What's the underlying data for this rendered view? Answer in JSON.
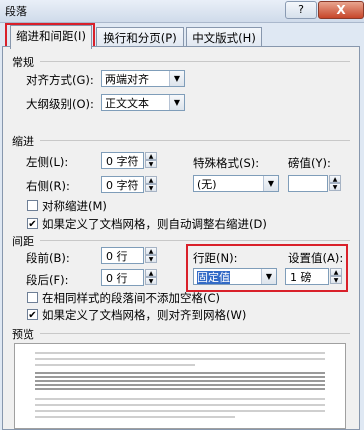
{
  "window": {
    "title": "段落",
    "help_label": "?",
    "close_label": "X"
  },
  "tabs": [
    {
      "label": "缩进和间距(I)",
      "active": true
    },
    {
      "label": "换行和分页(P)",
      "active": false
    },
    {
      "label": "中文版式(H)",
      "active": false
    }
  ],
  "general": {
    "section_label": "常规",
    "alignment_label": "对齐方式(G):",
    "alignment_value": "两端对齐",
    "outline_label": "大纲级别(O):",
    "outline_value": "正文文本"
  },
  "indent": {
    "section_label": "缩进",
    "left_label": "左侧(L):",
    "left_value": "0 字符",
    "right_label": "右侧(R):",
    "right_value": "0 字符",
    "special_label": "特殊格式(S):",
    "special_value": "(无)",
    "by_label": "磅值(Y):",
    "by_value": "",
    "mirror_label": "对称缩进(M)",
    "mirror_checked": false,
    "auto_adjust_label": "如果定义了文档网格，则自动调整右缩进(D)",
    "auto_adjust_checked": true
  },
  "spacing": {
    "section_label": "间距",
    "before_label": "段前(B):",
    "before_value": "0 行",
    "after_label": "段后(F):",
    "after_value": "0 行",
    "line_spacing_label": "行距(N):",
    "line_spacing_value": "固定值",
    "at_label": "设置值(A):",
    "at_value": "1 磅",
    "no_space_same_style_label": "在相同样式的段落间不添加空格(C)",
    "no_space_same_style_checked": false,
    "snap_grid_label": "如果定义了文档网格，则对齐到网格(W)",
    "snap_grid_checked": true
  },
  "preview": {
    "section_label": "预览"
  },
  "colors": {
    "highlight": "#d9202a",
    "selection": "#3169c6"
  }
}
